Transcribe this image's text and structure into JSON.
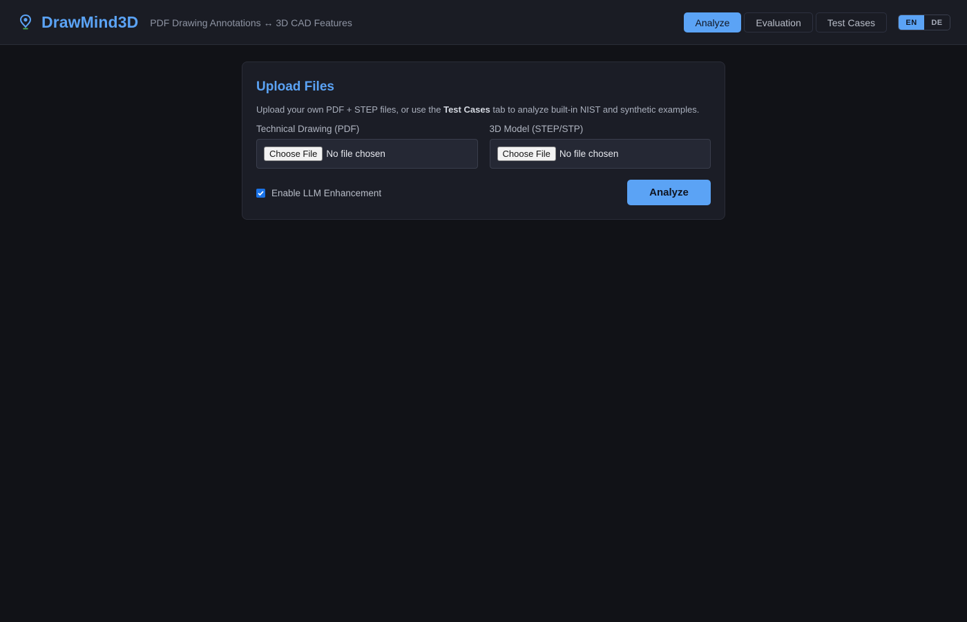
{
  "header": {
    "app_title": "DrawMind3D",
    "subtitle": "PDF Drawing Annotations ↔ 3D CAD Features",
    "logo_icon": "location-pin-icon"
  },
  "nav": {
    "tabs": [
      {
        "label": "Analyze",
        "active": true
      },
      {
        "label": "Evaluation",
        "active": false
      },
      {
        "label": "Test Cases",
        "active": false
      }
    ]
  },
  "language": {
    "options": [
      {
        "label": "EN",
        "active": true
      },
      {
        "label": "DE",
        "active": false
      }
    ]
  },
  "upload": {
    "title": "Upload Files",
    "desc_before": "Upload your own PDF + STEP files, or use the ",
    "desc_bold": "Test Cases",
    "desc_after": " tab to analyze built-in NIST and synthetic examples.",
    "pdf_label": "Technical Drawing (PDF)",
    "step_label": "3D Model (STEP/STP)",
    "choose_file": "Choose File",
    "no_file": "No file chosen",
    "llm_label": "Enable LLM Enhancement",
    "llm_checked": true,
    "analyze_label": "Analyze"
  },
  "colors": {
    "accent": "#5ba3f5",
    "background": "#111217",
    "panel": "#1b1d26"
  }
}
